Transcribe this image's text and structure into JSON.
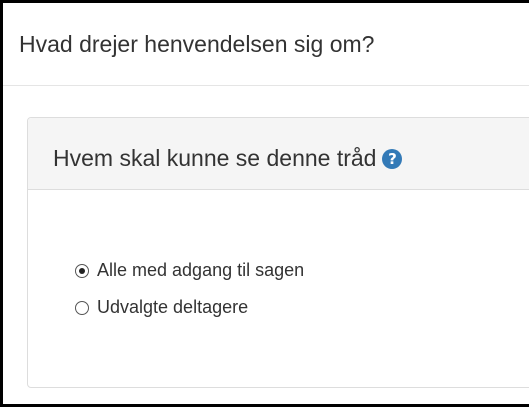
{
  "page": {
    "title": "Hvad drejer henvendelsen sig om?"
  },
  "visibility_panel": {
    "title": "Hvem skal kunne se denne tråd",
    "help_icon": "question-circle-icon",
    "help_icon_glyph": "?",
    "options": [
      {
        "label": "Alle med adgang til sagen",
        "selected": true
      },
      {
        "label": "Udvalgte deltagere",
        "selected": false
      }
    ]
  },
  "colors": {
    "accent": "#337ab7",
    "panel_heading_bg": "#f5f5f5",
    "border": "#dddddd",
    "text": "#333333"
  }
}
